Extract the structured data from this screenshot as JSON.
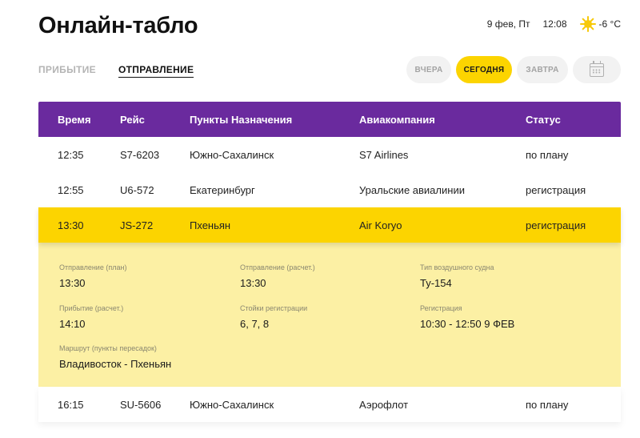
{
  "header": {
    "title": "Онлайн-табло",
    "date": "9 фев, Пт",
    "time": "12:08",
    "weather": {
      "icon": "sun-icon",
      "temperature": "-6 °C"
    }
  },
  "direction_tabs": [
    {
      "label": "ПРИБЫТИЕ",
      "active": false
    },
    {
      "label": "ОТПРАВЛЕНИЕ",
      "active": true
    }
  ],
  "day_tabs": [
    {
      "label": "ВЧЕРА",
      "active": false
    },
    {
      "label": "СЕГОДНЯ",
      "active": true
    },
    {
      "label": "ЗАВТРА",
      "active": false
    }
  ],
  "calendar_icon": "calendar-icon",
  "colors": {
    "header_purple": "#6a2a9e",
    "accent_yellow": "#fcd400",
    "details_bg": "#fcf0a4"
  },
  "table": {
    "columns": [
      "Время",
      "Рейс",
      "Пункты Назначения",
      "Авиакомпания",
      "Статус"
    ],
    "rows": [
      {
        "time": "12:35",
        "flight": "S7-6203",
        "destination": "Южно-Сахалинск",
        "airline": "S7 Airlines",
        "status": "по плану"
      },
      {
        "time": "12:55",
        "flight": "U6-572",
        "destination": "Екатеринбург",
        "airline": "Уральские авиалинии",
        "status": "регистрация"
      },
      {
        "time": "13:30",
        "flight": "JS-272",
        "destination": "Пхеньян",
        "airline": "Air Koryo",
        "status": "регистрация",
        "selected": true
      },
      {
        "time": "16:15",
        "flight": "SU-5606",
        "destination": "Южно-Сахалинск",
        "airline": "Аэрофлот",
        "status": "по плану"
      }
    ]
  },
  "details": {
    "departure_plan": {
      "label": "Отправление (план)",
      "value": "13:30"
    },
    "departure_est": {
      "label": "Отправление (расчет.)",
      "value": "13:30"
    },
    "aircraft_type": {
      "label": "Тип воздушного судна",
      "value": "Ту-154"
    },
    "arrival_est": {
      "label": "Прибытие (расчет.)",
      "value": "14:10"
    },
    "checkin_counters": {
      "label": "Стойки регистрации",
      "value": "6, 7, 8"
    },
    "checkin": {
      "label": "Регистрация",
      "value": "10:30 - 12:50 9 ФЕВ"
    },
    "route": {
      "label": "Маршрут (пункты пересадок)",
      "value": "Владивосток - Пхеньян"
    }
  }
}
